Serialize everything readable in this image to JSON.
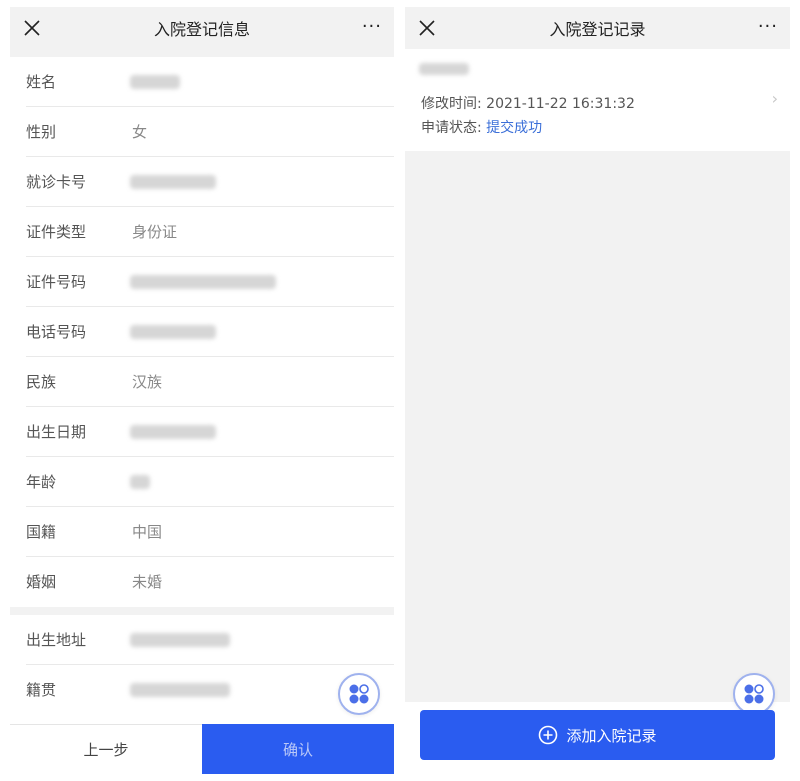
{
  "left": {
    "header": {
      "title": "入院登记信息",
      "close_icon": "close-icon",
      "more_label": "···"
    },
    "fields": [
      {
        "label": "姓名",
        "value": ""
      },
      {
        "label": "性别",
        "value": "女"
      },
      {
        "label": "就诊卡号",
        "value": ""
      },
      {
        "label": "证件类型",
        "value": "身份证"
      },
      {
        "label": "证件号码",
        "value": ""
      },
      {
        "label": "电话号码",
        "value": ""
      },
      {
        "label": "民族",
        "value": "汉族"
      },
      {
        "label": "出生日期",
        "value": ""
      },
      {
        "label": "年龄",
        "value": ""
      },
      {
        "label": "国籍",
        "value": "中国"
      },
      {
        "label": "婚姻",
        "value": "未婚"
      },
      {
        "label": "出生地址",
        "value": ""
      },
      {
        "label": "籍贯",
        "value": ""
      }
    ],
    "footer": {
      "prev_label": "上一步",
      "confirm_label": "确认"
    },
    "accent_color": "#2a5cf0"
  },
  "right": {
    "header": {
      "title": "入院登记记录",
      "close_icon": "close-icon",
      "more_label": "···"
    },
    "record": {
      "modified_label": "修改时间:",
      "modified_value": "2021-11-22 16:31:32",
      "status_label": "申请状态:",
      "status_value": "提交成功"
    },
    "add_button_label": "添加入院记录",
    "accent_color": "#2a5cf0"
  }
}
